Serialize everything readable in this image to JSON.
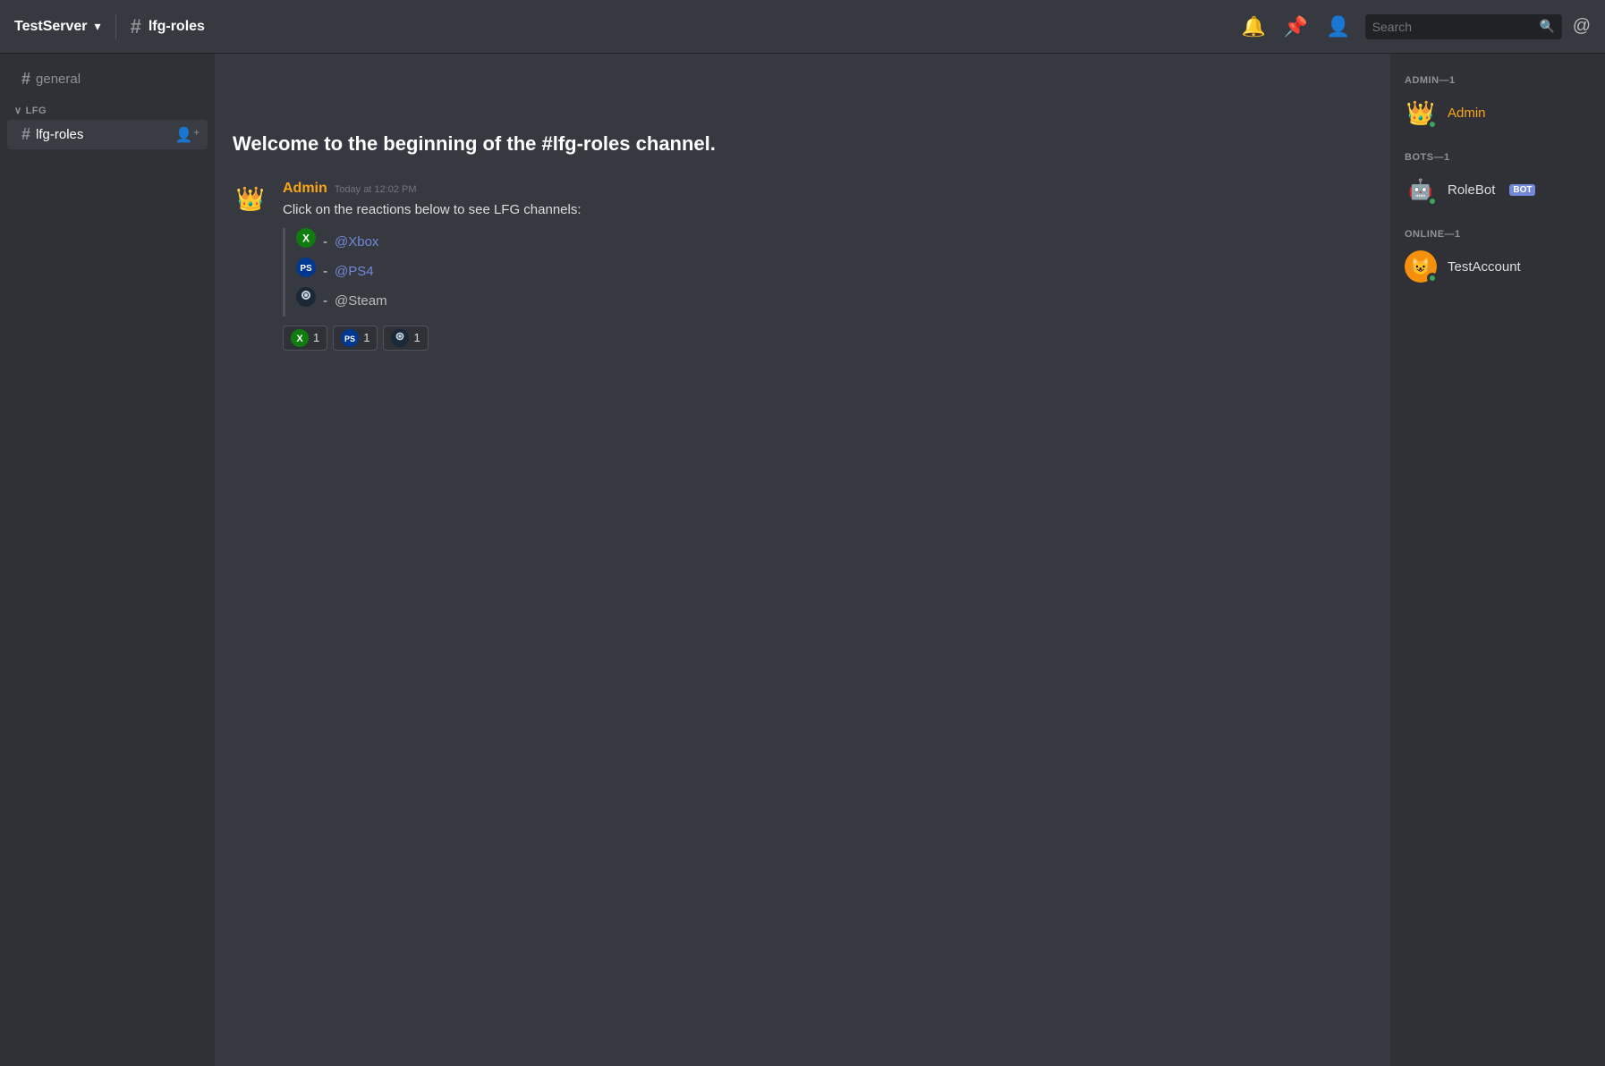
{
  "header": {
    "server_name": "TestServer",
    "dropdown_arrow": "▾",
    "channel_name": "lfg-roles",
    "search_placeholder": "Search"
  },
  "sidebar": {
    "channels": [
      {
        "name": "general",
        "active": false
      }
    ],
    "categories": [
      {
        "name": "LFG",
        "channels": [
          {
            "name": "lfg-roles",
            "active": true
          }
        ]
      }
    ]
  },
  "main": {
    "welcome_text_prefix": "Welcome to the beginning of the ",
    "welcome_channel": "#lfg-roles",
    "welcome_text_suffix": " channel.",
    "message": {
      "author": "Admin",
      "timestamp": "Today at 12:02 PM",
      "text": "Click on the reactions below to see LFG channels:",
      "list_items": [
        {
          "emoji_type": "xbox",
          "mention": "@Xbox"
        },
        {
          "emoji_type": "ps4",
          "mention": "@PS4"
        },
        {
          "emoji_type": "steam",
          "mention": "@Steam"
        }
      ],
      "reactions": [
        {
          "emoji_type": "xbox",
          "count": "1"
        },
        {
          "emoji_type": "ps4",
          "count": "1"
        },
        {
          "emoji_type": "steam",
          "count": "1"
        }
      ]
    }
  },
  "members": {
    "groups": [
      {
        "title": "ADMIN—1",
        "members": [
          {
            "name": "Admin",
            "avatar_type": "crown",
            "status": "online",
            "is_admin": true
          }
        ]
      },
      {
        "title": "BOTS—1",
        "members": [
          {
            "name": "RoleBot",
            "avatar_type": "robot",
            "status": "online",
            "is_bot": true
          }
        ]
      },
      {
        "title": "ONLINE—1",
        "members": [
          {
            "name": "TestAccount",
            "avatar_type": "discord",
            "status": "online"
          }
        ]
      }
    ]
  },
  "icons": {
    "hash": "#",
    "bell": "🔔",
    "pin": "📌",
    "members": "👤",
    "search": "🔍",
    "at": "@",
    "crown": "👑",
    "xbox": "Ⓧ",
    "robot": "🤖",
    "discord_face": "😺"
  }
}
